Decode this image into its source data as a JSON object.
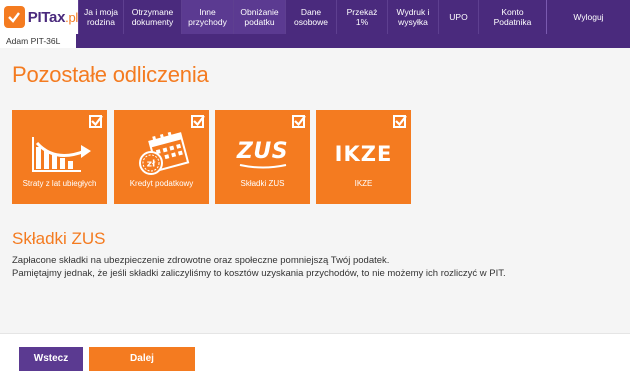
{
  "logo": {
    "text": "PITax",
    "suffix": ".pl"
  },
  "nav": [
    {
      "label": "Ja i moja rodzina",
      "active": false
    },
    {
      "label": "Otrzymane dokumenty",
      "active": false
    },
    {
      "label": "Inne przychody",
      "active": true
    },
    {
      "label": "Obniżanie podatku",
      "active": true
    },
    {
      "label": "Dane osobowe",
      "active": false
    },
    {
      "label": "Przekaż 1%",
      "active": false
    },
    {
      "label": "Wydruk i wysyłka",
      "active": false
    },
    {
      "label": "UPO",
      "active": false
    },
    {
      "label": "Konto Podatnika",
      "active": false
    },
    {
      "label": "Wyloguj",
      "active": false
    }
  ],
  "user_tab": "Adam PIT-36L",
  "page_title": "Pozostałe odliczenia",
  "tiles": [
    {
      "label": "Straty z lat ubiegłych",
      "icon": "chart-loss-arrow-icon",
      "checked": true
    },
    {
      "label": "Kredyt podatkowy",
      "icon": "calendar-coin-icon",
      "checked": true
    },
    {
      "label": "Składki ZUS",
      "icon": "zus-logo-icon",
      "logo_text": "ZUS",
      "checked": true
    },
    {
      "label": "IKZE",
      "icon": "ikze-logo-icon",
      "logo_text": "IKZE",
      "checked": true
    }
  ],
  "section": {
    "title": "Składki ZUS",
    "line1": "Zapłacone składki na ubezpieczenie zdrowotne oraz społeczne pomniejszą Twój podatek.",
    "line2": "Pamiętajmy jednak, że jeśli składki zaliczyliśmy to kosztów uzyskania przychodów, to nie możemy ich rozliczyć w PIT."
  },
  "buttons": {
    "back": "Wstecz",
    "next": "Dalej"
  },
  "colors": {
    "purple": "#4a2a7d",
    "orange": "#f47b20",
    "purple_button": "#5b3a91"
  }
}
